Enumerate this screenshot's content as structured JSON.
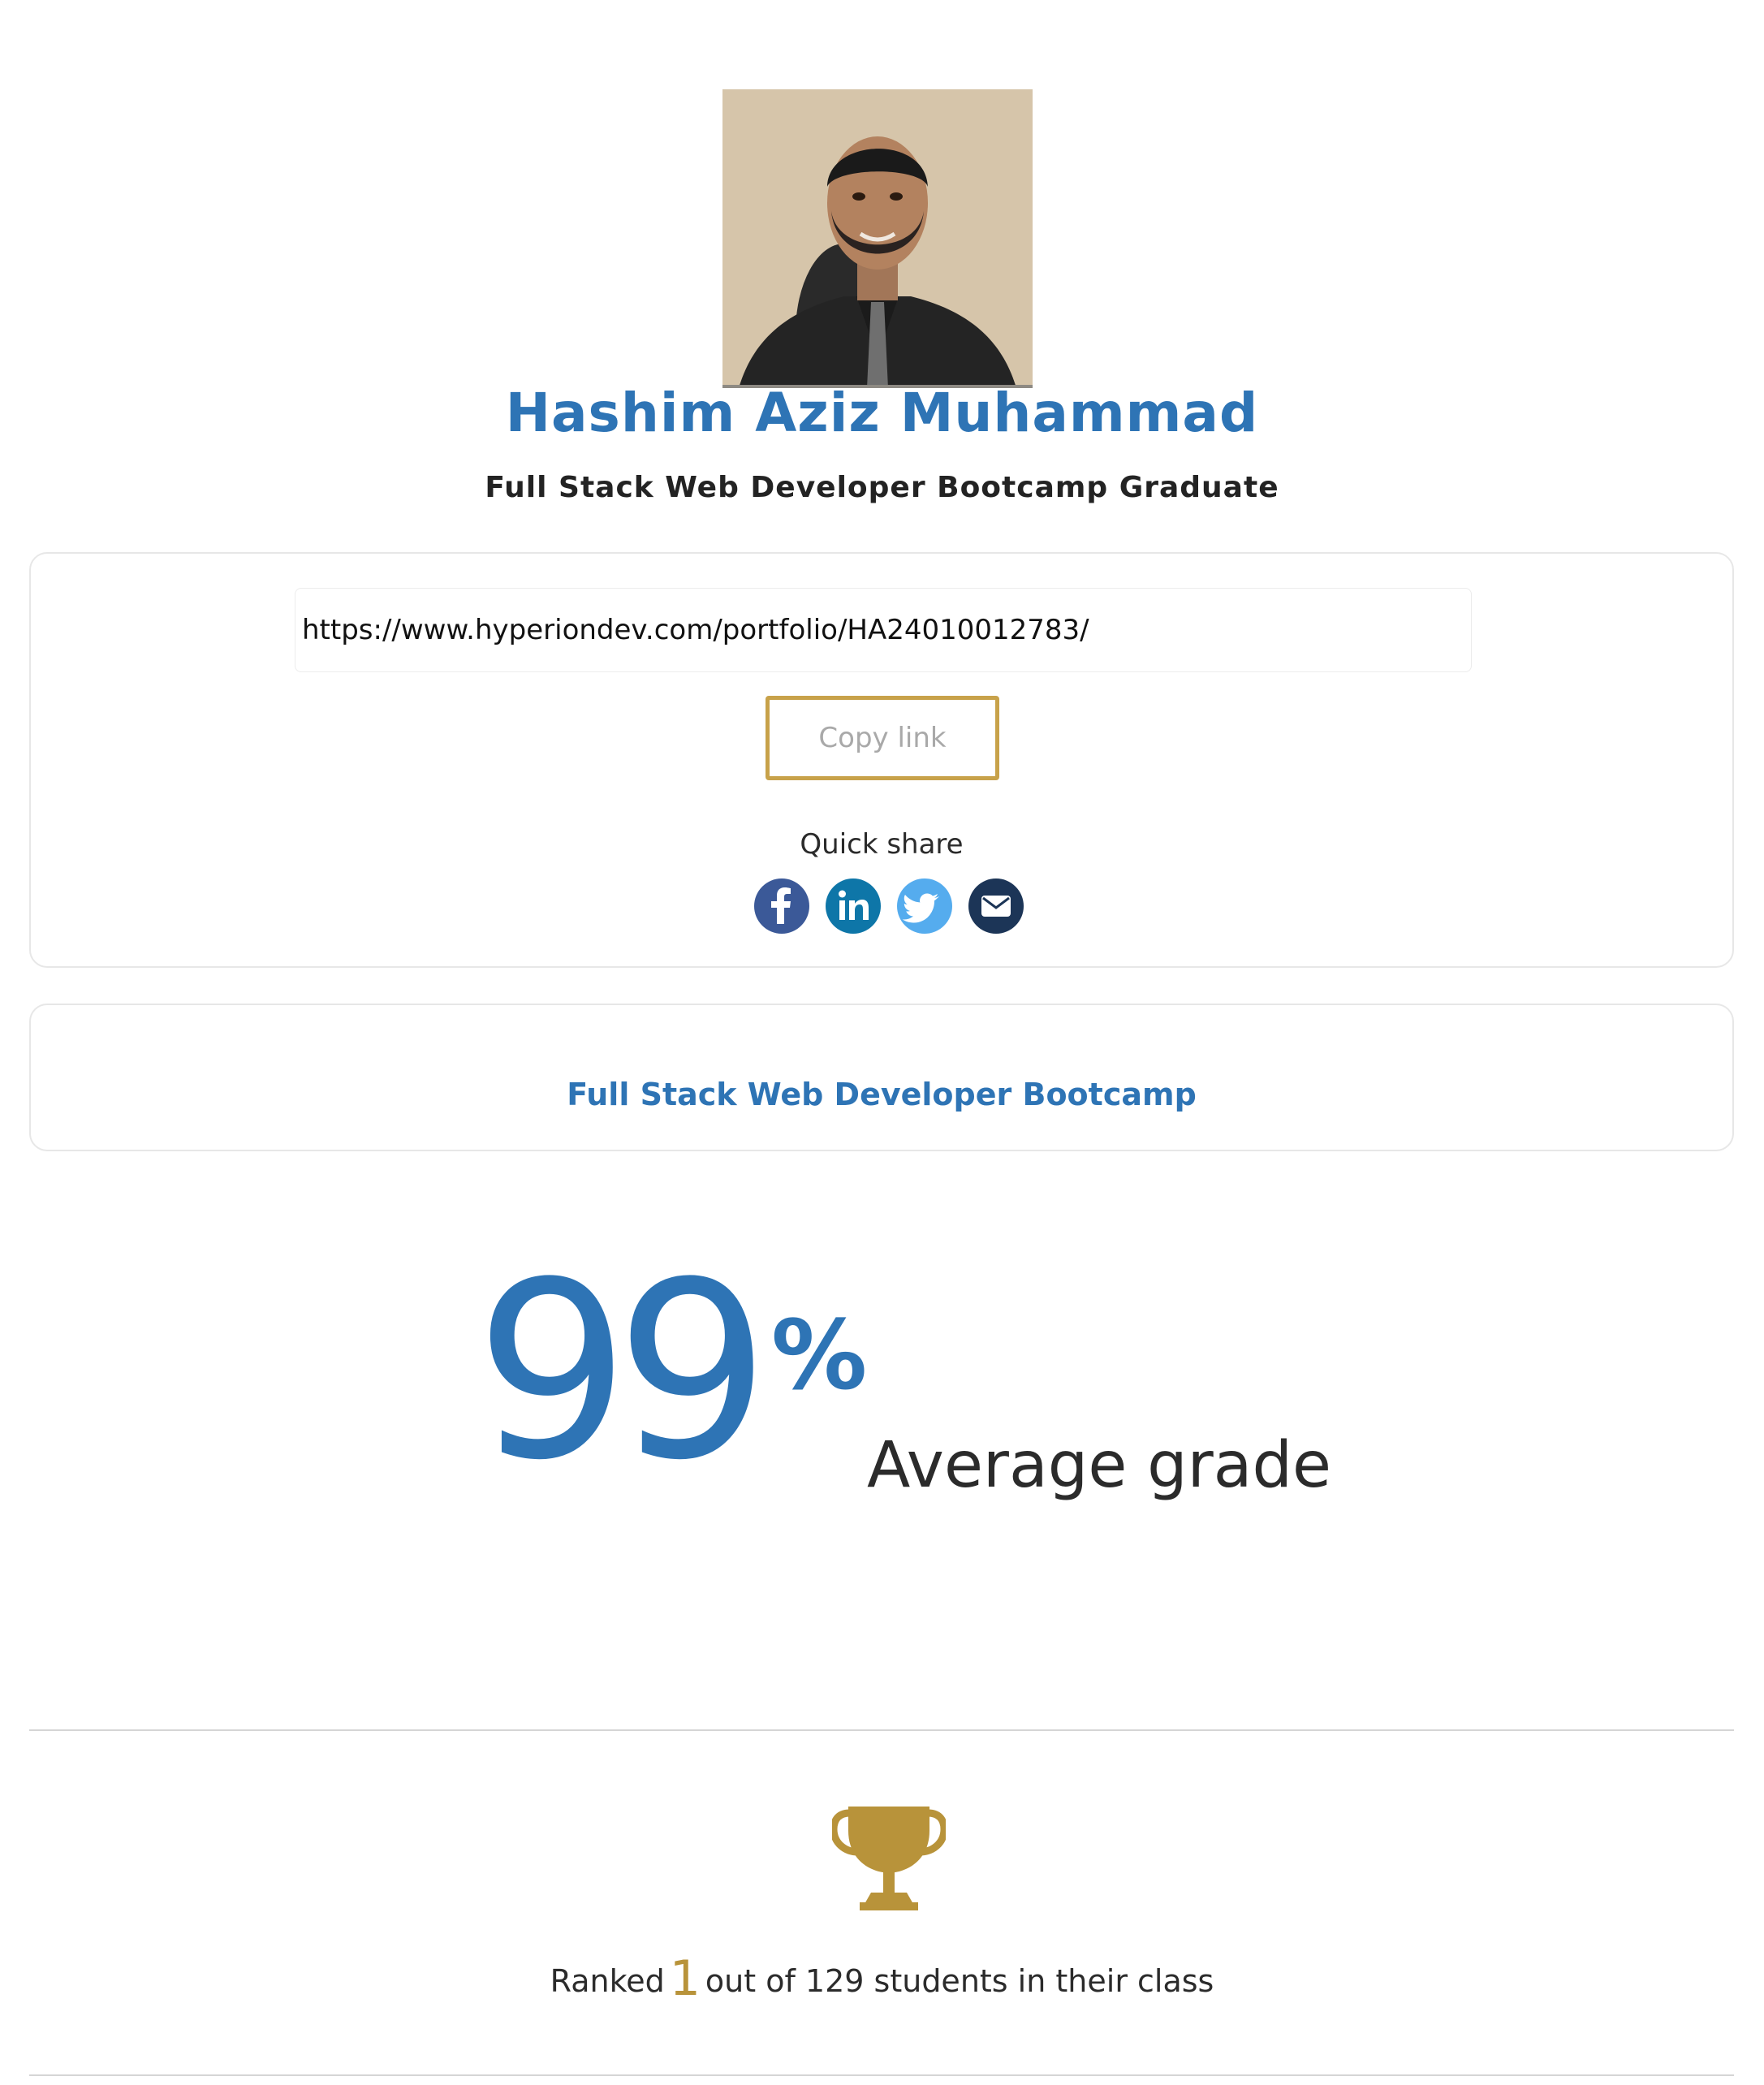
{
  "profile": {
    "name": "Hashim Aziz Muhammad",
    "subtitle": "Full Stack Web Developer Bootcamp Graduate"
  },
  "share": {
    "url": "https://www.hyperiondev.com/portfolio/HA24010012783/",
    "copy_label": "Copy link",
    "quick_share_label": "Quick share",
    "icons": [
      "facebook-icon",
      "linkedin-icon",
      "twitter-icon",
      "email-icon"
    ]
  },
  "course": {
    "title": "Full Stack Web Developer Bootcamp"
  },
  "grade": {
    "value": "99",
    "percent_sign": "%",
    "label": "Average grade"
  },
  "rank": {
    "prefix": "Ranked",
    "position": "1",
    "suffix": "out of 129 students in their class"
  },
  "colors": {
    "primary_blue": "#2e74b5",
    "gold": "#c8a24a",
    "facebook": "#3b5998",
    "linkedin": "#0e76a8",
    "twitter": "#55acee",
    "email": "#1c3557"
  }
}
